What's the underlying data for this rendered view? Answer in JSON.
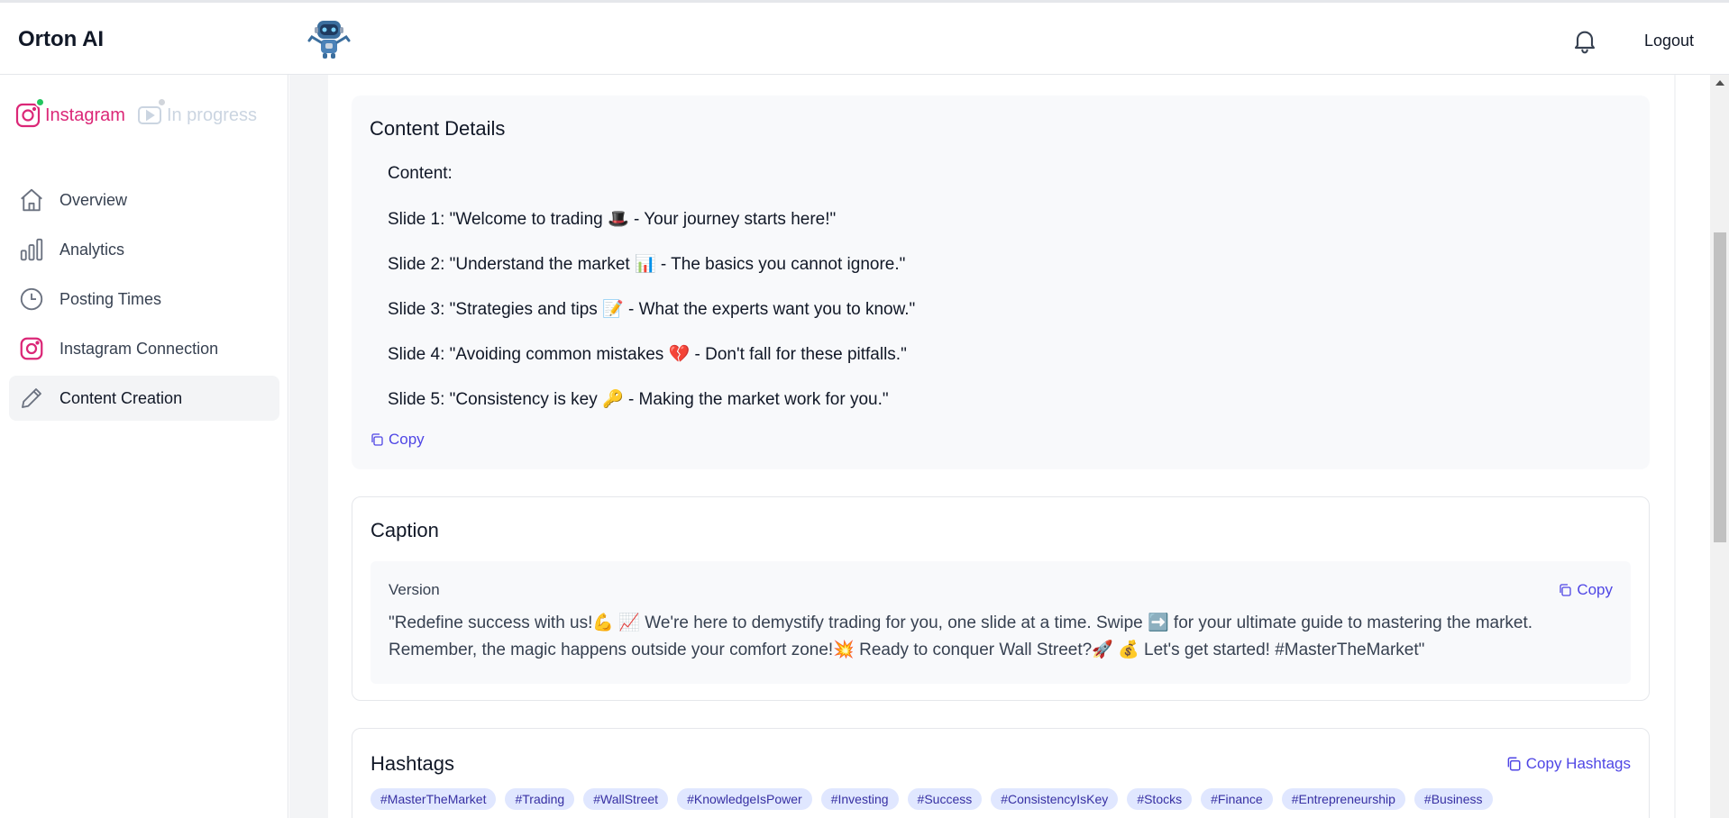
{
  "header": {
    "brand": "Orton AI",
    "logout_label": "Logout",
    "bell_icon": "bell-icon",
    "logo_icon": "robot-logo"
  },
  "sidebar": {
    "platforms": [
      {
        "label": "Instagram",
        "icon": "instagram-icon",
        "status_color": "#22c55e"
      },
      {
        "label": "In progress",
        "icon": "youtube-icon",
        "status_color": "#d1d5db"
      }
    ],
    "items": [
      {
        "label": "Overview",
        "icon": "home-icon"
      },
      {
        "label": "Analytics",
        "icon": "bar-chart-icon"
      },
      {
        "label": "Posting Times",
        "icon": "clock-icon"
      },
      {
        "label": "Instagram Connection",
        "icon": "instagram-icon"
      },
      {
        "label": "Content Creation",
        "icon": "pencil-icon",
        "active": true
      }
    ]
  },
  "content_details": {
    "title": "Content Details",
    "content_label": "Content:",
    "slides": [
      "Slide 1: \"Welcome to trading 🎩 - Your journey starts here!\"",
      "Slide 2: \"Understand the market 📊 - The basics you cannot ignore.\"",
      "Slide 3: \"Strategies and tips 📝 - What the experts want you to know.\"",
      "Slide 4: \"Avoiding common mistakes 💔 - Don't fall for these pitfalls.\"",
      "Slide 5: \"Consistency is key 🔑 - Making the market work for you.\""
    ],
    "copy_label": "Copy"
  },
  "caption": {
    "title": "Caption",
    "version_label": "Version",
    "copy_label": "Copy",
    "text": "\"Redefine success with us!💪 📈 We're here to demystify trading for you, one slide at a time. Swipe ➡️ for your ultimate guide to mastering the market. Remember, the magic happens outside your comfort zone!💥 Ready to conquer Wall Street?🚀 💰 Let's get started! #MasterTheMarket\""
  },
  "hashtags": {
    "title": "Hashtags",
    "copy_label": "Copy Hashtags",
    "tags": [
      "#MasterTheMarket",
      "#Trading",
      "#WallStreet",
      "#KnowledgeIsPower",
      "#Investing",
      "#Success",
      "#ConsistencyIsKey",
      "#Stocks",
      "#Finance",
      "#Entrepreneurship",
      "#Business"
    ]
  },
  "colors": {
    "accent": "#4f46e5",
    "instagram": "#db2777",
    "tag_bg": "#e0e7ff",
    "tag_text": "#3730a3"
  }
}
